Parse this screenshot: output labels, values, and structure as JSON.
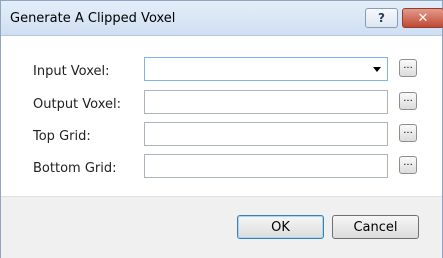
{
  "window": {
    "title": "Generate A Clipped Voxel",
    "help_glyph": "?",
    "close_glyph": "✕"
  },
  "form": {
    "fields": [
      {
        "label": "Input Voxel:",
        "value": "",
        "type": "dropdown"
      },
      {
        "label": "Output Voxel:",
        "value": "",
        "type": "text"
      },
      {
        "label": "Top Grid:",
        "value": "",
        "type": "text"
      },
      {
        "label": "Bottom Grid:",
        "value": "",
        "type": "text"
      }
    ],
    "browse_label": "..."
  },
  "buttons": {
    "ok": "OK",
    "cancel": "Cancel"
  },
  "colors": {
    "titlebar": "#cfdff2",
    "close_button": "#c04a35",
    "focus_border": "#7eb4ea"
  },
  "icons": [
    "help-icon",
    "close-icon",
    "dropdown-arrow-icon",
    "browse-icon"
  ]
}
